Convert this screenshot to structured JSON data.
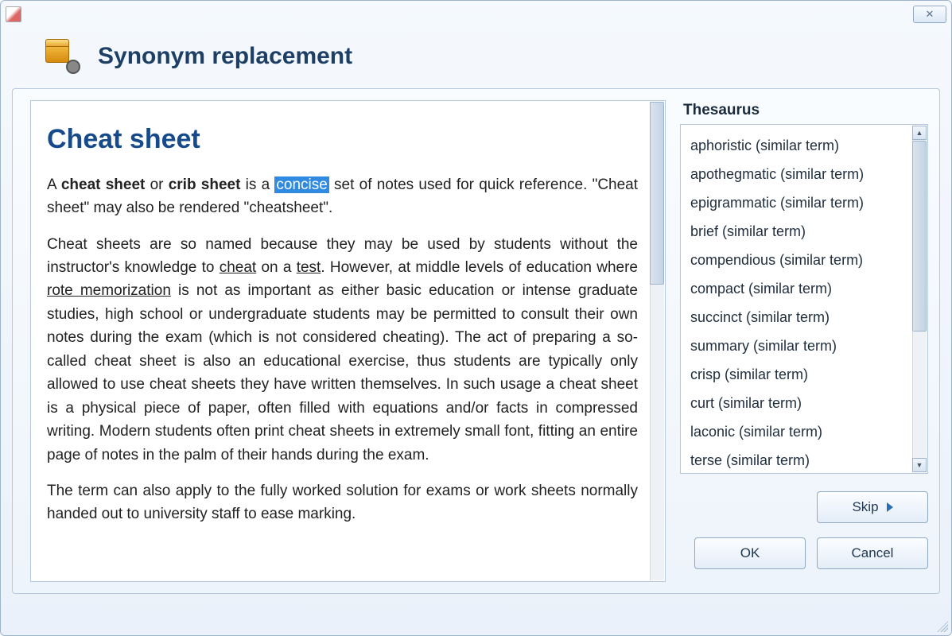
{
  "dialog": {
    "title": "Synonym replacement"
  },
  "document": {
    "heading": "Cheat sheet",
    "p1_a": "A ",
    "p1_b1": "cheat sheet",
    "p1_c": " or ",
    "p1_b2": "crib sheet",
    "p1_d": " is a ",
    "p1_hl": "concise",
    "p1_e": " set of notes used for quick reference. \"Cheat sheet\" may also be rendered \"cheatsheet\".",
    "p2_a": "Cheat sheets are so named because they may be used by students without the instructor's knowledge to ",
    "p2_u1": "cheat",
    "p2_b": " on a ",
    "p2_u2": "test",
    "p2_c": ". However, at middle levels of education where ",
    "p2_u3": "rote memorization",
    "p2_d": " is not as important as either basic education or intense graduate studies, high school or undergraduate students may be permitted to consult their own notes during the exam (which is not considered cheating). The act of preparing a so-called cheat sheet is also an educational exercise, thus students are typically only allowed to use cheat sheets they have written themselves. In such usage a cheat sheet is a physical piece of paper, often filled with equations and/or facts in compressed writing. Modern students often print cheat sheets in extremely small font, fitting an entire page of notes in the palm of their hands during the exam.",
    "p3": "The term can also apply to the fully worked solution for exams or work sheets normally handed out to university staff to ease marking."
  },
  "thesaurus": {
    "title": "Thesaurus",
    "items": [
      "aphoristic (similar term)",
      "apothegmatic (similar term)",
      "epigrammatic (similar term)",
      "brief (similar term)",
      "compendious (similar term)",
      "compact (similar term)",
      "succinct (similar term)",
      "summary (similar term)",
      "crisp (similar term)",
      "curt (similar term)",
      "laconic (similar term)",
      "terse (similar term)"
    ]
  },
  "buttons": {
    "skip": "Skip",
    "ok": "OK",
    "cancel": "Cancel"
  }
}
